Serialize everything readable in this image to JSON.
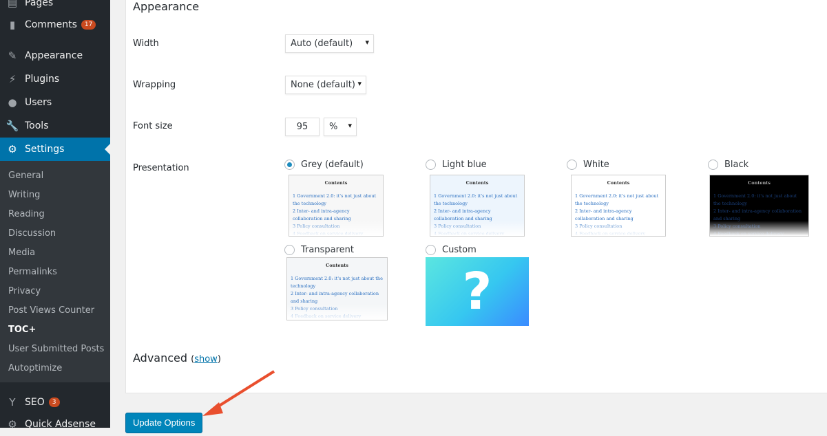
{
  "sidebar": {
    "items": [
      {
        "label": "Pages",
        "icon": "pages-icon",
        "glyph": "▤"
      },
      {
        "label": "Comments",
        "icon": "comments-icon",
        "glyph": "▮",
        "badge": "17"
      },
      {
        "label": "Appearance",
        "icon": "brush-icon",
        "glyph": "✎"
      },
      {
        "label": "Plugins",
        "icon": "plugin-icon",
        "glyph": "⚡"
      },
      {
        "label": "Users",
        "icon": "user-icon",
        "glyph": "●"
      },
      {
        "label": "Tools",
        "icon": "wrench-icon",
        "glyph": "🔧"
      },
      {
        "label": "Settings",
        "icon": "settings-icon",
        "glyph": "⚙"
      }
    ],
    "submenu": [
      "General",
      "Writing",
      "Reading",
      "Discussion",
      "Media",
      "Permalinks",
      "Privacy",
      "Post Views Counter",
      "TOC+",
      "User Submitted Posts",
      "Autoptimize"
    ],
    "bottom": [
      {
        "label": "SEO",
        "badge": "3",
        "icon": "yoast-icon",
        "glyph": "Y"
      },
      {
        "label": "Quick Adsense",
        "icon": "gear-icon",
        "glyph": "⚙"
      }
    ]
  },
  "main": {
    "appearance_heading": "Appearance",
    "width": {
      "label": "Width",
      "value": "Auto (default)"
    },
    "wrapping": {
      "label": "Wrapping",
      "value": "None (default)"
    },
    "font_size": {
      "label": "Font size",
      "value": "95",
      "unit": "%"
    },
    "presentation": {
      "label": "Presentation",
      "options": [
        "Grey (default)",
        "Light blue",
        "White",
        "Black",
        "Transparent",
        "Custom"
      ],
      "selected": "Grey (default)"
    },
    "preview": {
      "title": "Contents",
      "lines": [
        "1 Government 2.0: it's not just about the technology",
        "2 Inter- and intra-agency collaboration and sharing",
        "3 Policy consultation",
        "4 Feedback on service delivery"
      ]
    },
    "custom_glyph": "?",
    "advanced_heading": "Advanced",
    "advanced_link": "show",
    "update_button": "Update Options"
  }
}
